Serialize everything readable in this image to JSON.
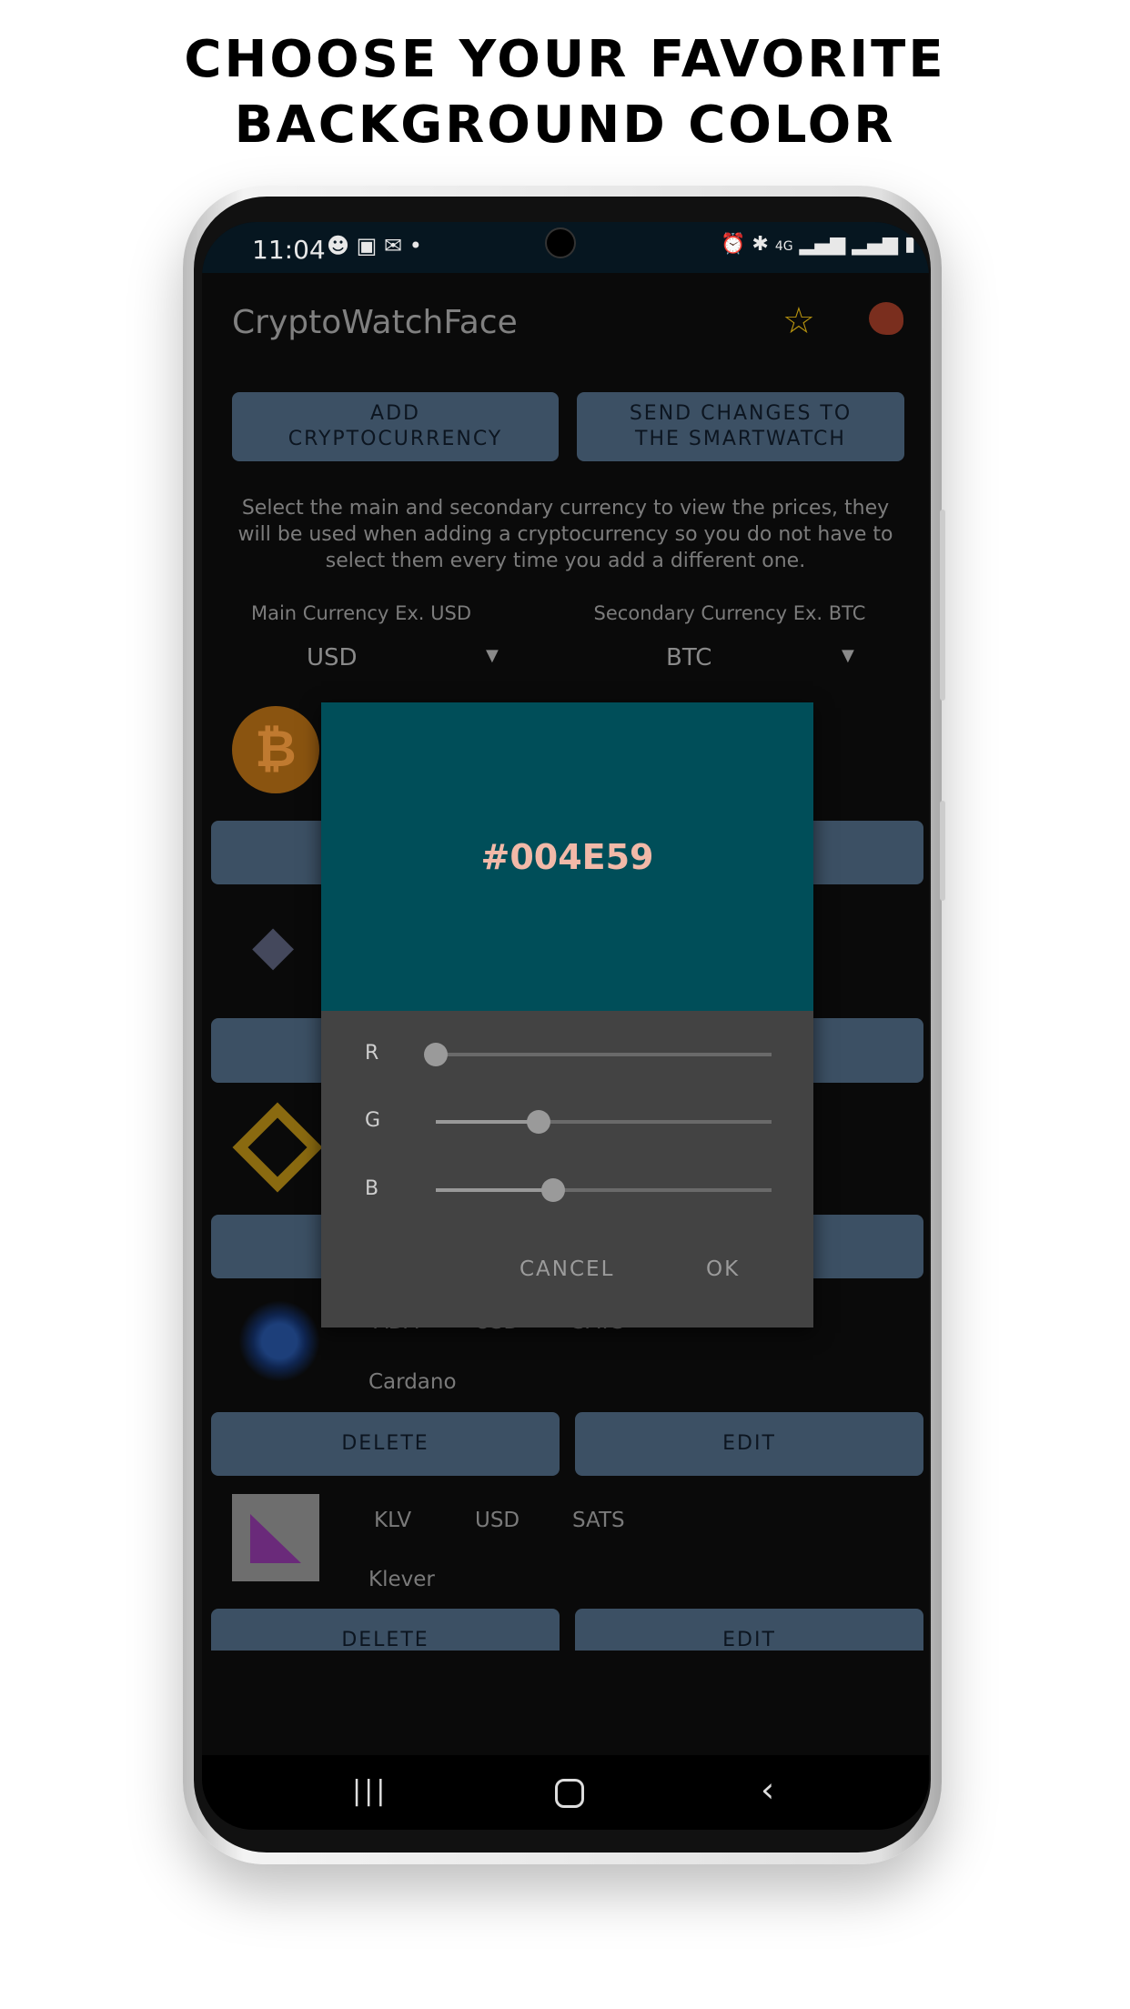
{
  "headline": {
    "line1": "CHOOSE YOUR FAVORITE",
    "line2": "BACKGROUND COLOR"
  },
  "status_bar": {
    "time": "11:04",
    "network": "4G"
  },
  "app": {
    "title": "CryptoWatchFace",
    "star_color": "#b8940f",
    "palette_color": "#7a2e1e"
  },
  "actions": {
    "add": "ADD CRYPTOCURRENCY",
    "send": "SEND CHANGES TO THE SMARTWATCH"
  },
  "description": "Select the main and secondary currency to view the prices, they will be used when adding a cryptocurrency so you do not have to select them every time you add a different one.",
  "currency": {
    "main_label": "Main Currency Ex. USD",
    "main_value": "USD",
    "secondary_label": "Secondary Currency Ex. BTC",
    "secondary_value": "BTC"
  },
  "coins": [
    {
      "icon": "bitcoin-icon"
    },
    {
      "icon": "ethereum-icon"
    },
    {
      "icon": "binance-icon"
    },
    {
      "icon": "cardano-icon",
      "symbol": "ADA",
      "main": "USD",
      "secondary": "SATS",
      "name": "Cardano",
      "delete": "DELETE",
      "edit": "EDIT"
    },
    {
      "icon": "klever-icon",
      "symbol": "KLV",
      "main": "USD",
      "secondary": "SATS",
      "name": "Klever",
      "delete": "DELETE",
      "edit": "EDIT"
    }
  ],
  "color_dialog": {
    "hex": "#004E59",
    "color": "#004e59",
    "r_label": "R",
    "g_label": "G",
    "b_label": "B",
    "r": 0,
    "g": 78,
    "b": 89,
    "max": 255,
    "cancel": "CANCEL",
    "ok": "OK"
  }
}
